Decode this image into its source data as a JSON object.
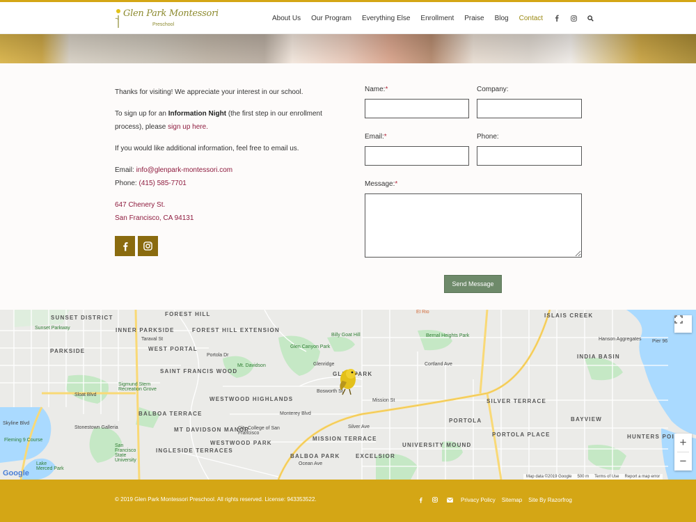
{
  "header": {
    "logo_text": "Glen Park Montessori",
    "logo_sub": "Preschool",
    "nav": [
      {
        "label": "About Us"
      },
      {
        "label": "Our Program"
      },
      {
        "label": "Everything Else"
      },
      {
        "label": "Enrollment"
      },
      {
        "label": "Praise"
      },
      {
        "label": "Blog"
      },
      {
        "label": "Contact"
      }
    ],
    "nav_icons": [
      "facebook-icon",
      "instagram-icon",
      "search-icon"
    ]
  },
  "intro": {
    "p1": "Thanks for visiting! We appreciate your interest in our school.",
    "p2_pre": "To sign up for an ",
    "p2_bold": "Information Night",
    "p2_mid": " (the first step in our enrollment process), please ",
    "p2_link": "sign up here.",
    "p3": "If you would like additional information, feel free to email us.",
    "email_label": "Email: ",
    "email": "info@glenpark-montessori.com",
    "phone_label": "Phone: ",
    "phone": "(415) 585-7701",
    "address1": "647 Chenery St.",
    "address2": "San Francisco, CA 94131"
  },
  "form": {
    "name_label": "Name:",
    "company_label": "Company:",
    "email_label": "Email:",
    "phone_label": "Phone:",
    "message_label": "Message:",
    "required_mark": "*",
    "send_label": "Send Message"
  },
  "map": {
    "labels": [
      "SUNSET DISTRICT",
      "FOREST HILL",
      "ISLAIS CREEK",
      "INNER PARKSIDE",
      "FOREST HILL EXTENSION",
      "PARKSIDE",
      "WEST PORTAL",
      "SAINT FRANCIS WOOD",
      "INDIA BASIN",
      "GLEN PARK",
      "WESTWOOD HIGHLANDS",
      "SILVER TERRACE",
      "BALBOA TERRACE",
      "PORTOLA",
      "BAYVIEW",
      "MT DAVIDSON MANOR",
      "WESTWOOD PARK",
      "MISSION TERRACE",
      "PORTOLA PLACE",
      "HUNTERS POINT",
      "INGLESIDE TERRACES",
      "BALBOA PARK",
      "EXCELSIOR",
      "UNIVERSITY MOUND"
    ],
    "small_labels": [
      "Sunset Parkway",
      "Billy Goat Hill",
      "Bernal Heights Park",
      "Hanson Aggregates",
      "Pier 96",
      "Glen Canyon Park",
      "Mt. Davidson",
      "Glenridge",
      "Sigmund Stern Recreation Grove",
      "Stonestown Galleria",
      "Fleming 9 Course",
      "San Francisco State University",
      "City College of San Francisco",
      "Lake Merced Park",
      "El Rio"
    ],
    "street_labels": [
      "Sloat Blvd",
      "Taraval St",
      "Portola Dr",
      "Monterey Blvd",
      "Ocean Ave",
      "Silver Ave",
      "Mission St",
      "Cortland Ave",
      "Bosworth St",
      "Skyline Blvd"
    ],
    "google": "Google",
    "footer_text": [
      "Map data ©2019 Google",
      "500 m",
      "Terms of Use",
      "Report a map error"
    ],
    "zoom_in": "+",
    "zoom_out": "−"
  },
  "footer": {
    "copyright": "© 2019 Glen Park Montessori Preschool. All rights reserved. License: 943353522.",
    "links": [
      "Privacy Policy",
      "Sitemap",
      "Site By Razorfrog"
    ]
  },
  "colors": {
    "gold": "#d4a615",
    "dark_gold": "#8a6b0f",
    "link": "#8e1b3e",
    "button": "#6e8a6a"
  }
}
